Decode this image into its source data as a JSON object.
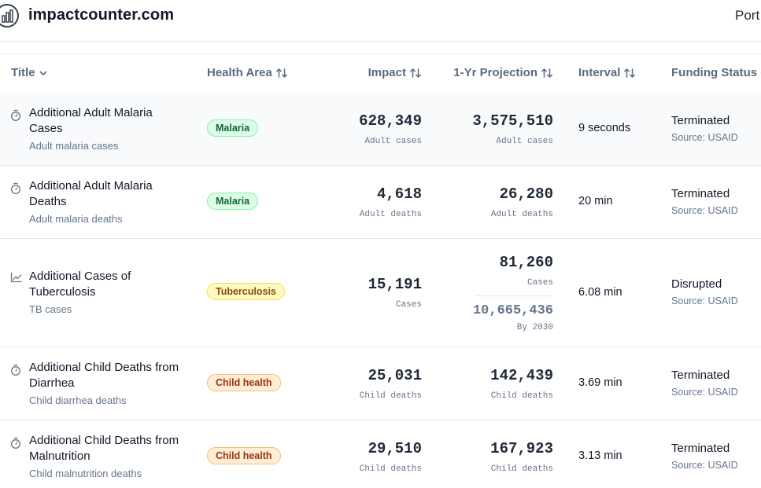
{
  "header": {
    "brand": "impactcounter.com",
    "nav_partial": "Port",
    "logo_icon": "bar-chart-logo-icon"
  },
  "table": {
    "columns": [
      {
        "label": "Title",
        "sort_icon": "chevron-down-icon"
      },
      {
        "label": "Health Area",
        "sort_icon": "sort-arrows-icon"
      },
      {
        "label": "Impact",
        "sort_icon": "sort-arrows-icon"
      },
      {
        "label": "1-Yr Projection",
        "sort_icon": "sort-arrows-icon"
      },
      {
        "label": "Interval",
        "sort_icon": "sort-arrows-icon"
      },
      {
        "label": "Funding Status",
        "sort_icon": "sort-arrows-icon"
      }
    ],
    "rows": [
      {
        "icon": "timer-icon",
        "title": "Additional Adult Malaria Cases",
        "subtitle": "Adult malaria cases",
        "health_area": "Malaria",
        "impact": "628,349",
        "impact_unit": "Adult cases",
        "projection": "3,575,510",
        "projection_unit": "Adult cases",
        "interval": "9 seconds",
        "funding_status": "Terminated",
        "funding_source": "Source: USAID"
      },
      {
        "icon": "timer-icon",
        "title": "Additional Adult Malaria Deaths",
        "subtitle": "Adult malaria deaths",
        "health_area": "Malaria",
        "impact": "4,618",
        "impact_unit": "Adult deaths",
        "projection": "26,280",
        "projection_unit": "Adult deaths",
        "interval": "20 min",
        "funding_status": "Terminated",
        "funding_source": "Source: USAID"
      },
      {
        "icon": "trend-chart-icon",
        "title": "Additional Cases of Tuberculosis",
        "subtitle": "TB cases",
        "health_area": "Tuberculosis",
        "impact": "15,191",
        "impact_unit": "Cases",
        "projection": "81,260",
        "projection_unit": "Cases",
        "projection_extra": "10,665,436",
        "projection_extra_unit": "By 2030",
        "interval": "6.08 min",
        "funding_status": "Disrupted",
        "funding_source": "Source: USAID"
      },
      {
        "icon": "timer-icon",
        "title": "Additional Child Deaths from Diarrhea",
        "subtitle": "Child diarrhea deaths",
        "health_area": "Child health",
        "impact": "25,031",
        "impact_unit": "Child deaths",
        "projection": "142,439",
        "projection_unit": "Child deaths",
        "interval": "3.69 min",
        "funding_status": "Terminated",
        "funding_source": "Source: USAID"
      },
      {
        "icon": "timer-icon",
        "title": "Additional Child Deaths from Malnutrition",
        "subtitle": "Child malnutrition deaths",
        "health_area": "Child health",
        "impact": "29,510",
        "impact_unit": "Child deaths",
        "projection": "167,923",
        "projection_unit": "Child deaths",
        "interval": "3.13 min",
        "funding_status": "Terminated",
        "funding_source": "Source: USAID"
      }
    ]
  },
  "colors": {
    "malaria_badge_bg": "#dcfce7",
    "tuberculosis_badge_bg": "#fef9c3",
    "child_health_badge_bg": "#ffedd5",
    "header_text": "#5b6b82"
  }
}
